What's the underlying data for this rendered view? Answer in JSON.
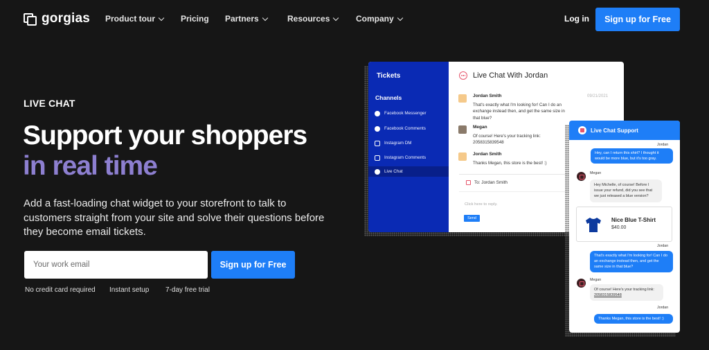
{
  "nav": {
    "logo": "gorgias",
    "items": [
      {
        "label": "Product tour",
        "dropdown": true
      },
      {
        "label": "Pricing",
        "dropdown": false
      },
      {
        "label": "Partners",
        "dropdown": true
      },
      {
        "label": "Resources",
        "dropdown": true
      },
      {
        "label": "Company",
        "dropdown": true
      }
    ],
    "login": "Log in",
    "cta": "Sign up for Free"
  },
  "hero": {
    "eyebrow": "LIVE CHAT",
    "headline_1": "Support your shoppers",
    "headline_2": "in real time",
    "subtitle": "Add a fast-loading chat widget to your storefront to talk to customers straight from your site and solve their questions before they become email tickets.",
    "email_placeholder": "Your work email",
    "cta": "Sign up for Free",
    "perks": [
      "No credit card required",
      "Instant setup",
      "7-day free trial"
    ]
  },
  "helpdesk": {
    "sidebar_title": "Tickets",
    "channels_label": "Channels",
    "channels": [
      "Facebook Messenger",
      "Facebook Comments",
      "Instagram DM",
      "Instagram Comments",
      "Live Chat"
    ],
    "active_channel": "Live Chat",
    "conversation_title": "Live Chat With Jordan",
    "date": "09/21/2021",
    "messages": [
      {
        "name": "Jordan Smith",
        "text": "That's exactly what I'm looking for! Can I do an exchange instead then, and get the same size in that blue?"
      },
      {
        "name": "Megan",
        "text": "Of course! Here's your tracking link: 2058315839548"
      },
      {
        "name": "Jordan Smith",
        "text": "Thanks Megan, this store is the best! :)"
      }
    ],
    "reply_to": "To: Jordan Smith",
    "reply_placeholder": "Click here to reply.",
    "send": "Send"
  },
  "widget": {
    "title": "Live Chat Support",
    "customer_name": "Jordan",
    "agent_name": "Megan",
    "msg1": "Hey, can I return this shirt? I thought it would be more blue, but it's too gray.",
    "msg2": "Hey Michelle, of course! Before I issue your refund, did you see that we just released a blue version?",
    "product_name": "Nice Blue T-Shirt",
    "product_price": "$40.00",
    "msg3": "That's exactly what I'm looking for! Can I do an exchange instead then, and get the same size in that blue?",
    "msg4_prefix": "Of course! Here's your tracking link: ",
    "msg4_link": "2058315839548",
    "msg5": "Thanks Megan, this store is the best! :)"
  },
  "colors": {
    "accent": "#1e7ef7",
    "sidebar": "#0a2ab4",
    "highlight": "#8d7fd0",
    "background": "#161616"
  }
}
